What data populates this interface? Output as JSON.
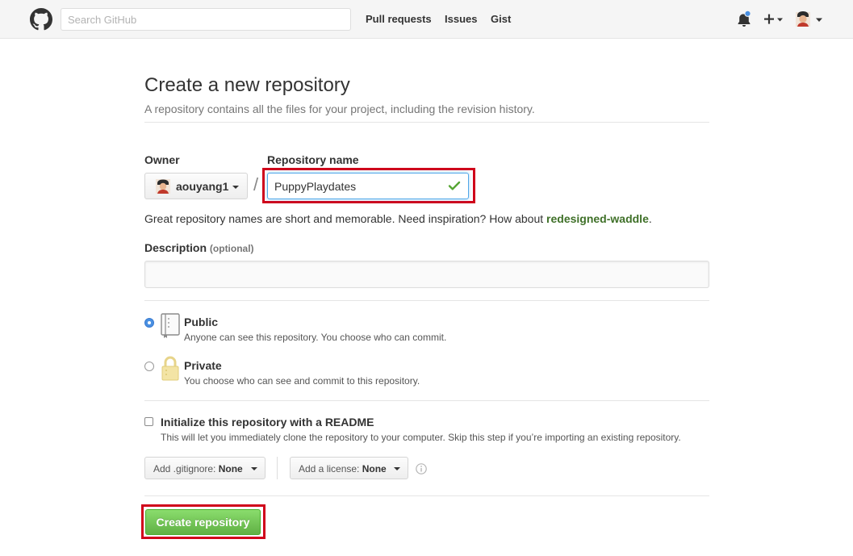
{
  "header": {
    "search_placeholder": "Search GitHub",
    "nav": [
      "Pull requests",
      "Issues",
      "Gist"
    ],
    "icons": {
      "logo": "github-octocat-icon",
      "notifications": "bell-icon",
      "create": "plus-icon",
      "user": "avatar-icon"
    },
    "notification_dot_color": "#4a90e2"
  },
  "page": {
    "title": "Create a new repository",
    "subtitle": "A repository contains all the files for your project, including the revision history."
  },
  "form": {
    "owner_label": "Owner",
    "owner_value": "aouyang1",
    "separator": "/",
    "repo_name_label": "Repository name",
    "repo_name_value": "PuppyPlaydates",
    "repo_name_valid": true,
    "hint_prefix": "Great repository names are short and memorable. Need inspiration? How about ",
    "hint_suggestion": "redesigned-waddle",
    "hint_suffix": ".",
    "description_label": "Description",
    "description_optional": "(optional)",
    "description_value": "",
    "visibility": {
      "selected": "public",
      "public_title": "Public",
      "public_note": "Anyone can see this repository. You choose who can commit.",
      "private_title": "Private",
      "private_note": "You choose who can see and commit to this repository."
    },
    "readme": {
      "checked": false,
      "title": "Initialize this repository with a README",
      "note": "This will let you immediately clone the repository to your computer. Skip this step if you’re importing an existing repository."
    },
    "gitignore_prefix": "Add .gitignore:",
    "gitignore_value": "None",
    "license_prefix": "Add a license:",
    "license_value": "None",
    "submit_label": "Create repository"
  },
  "colors": {
    "annotation_highlight": "#d0021b",
    "submit_green": "#60b044",
    "suggestion_green": "#3f7028",
    "radio_selected": "#4a90e2"
  }
}
